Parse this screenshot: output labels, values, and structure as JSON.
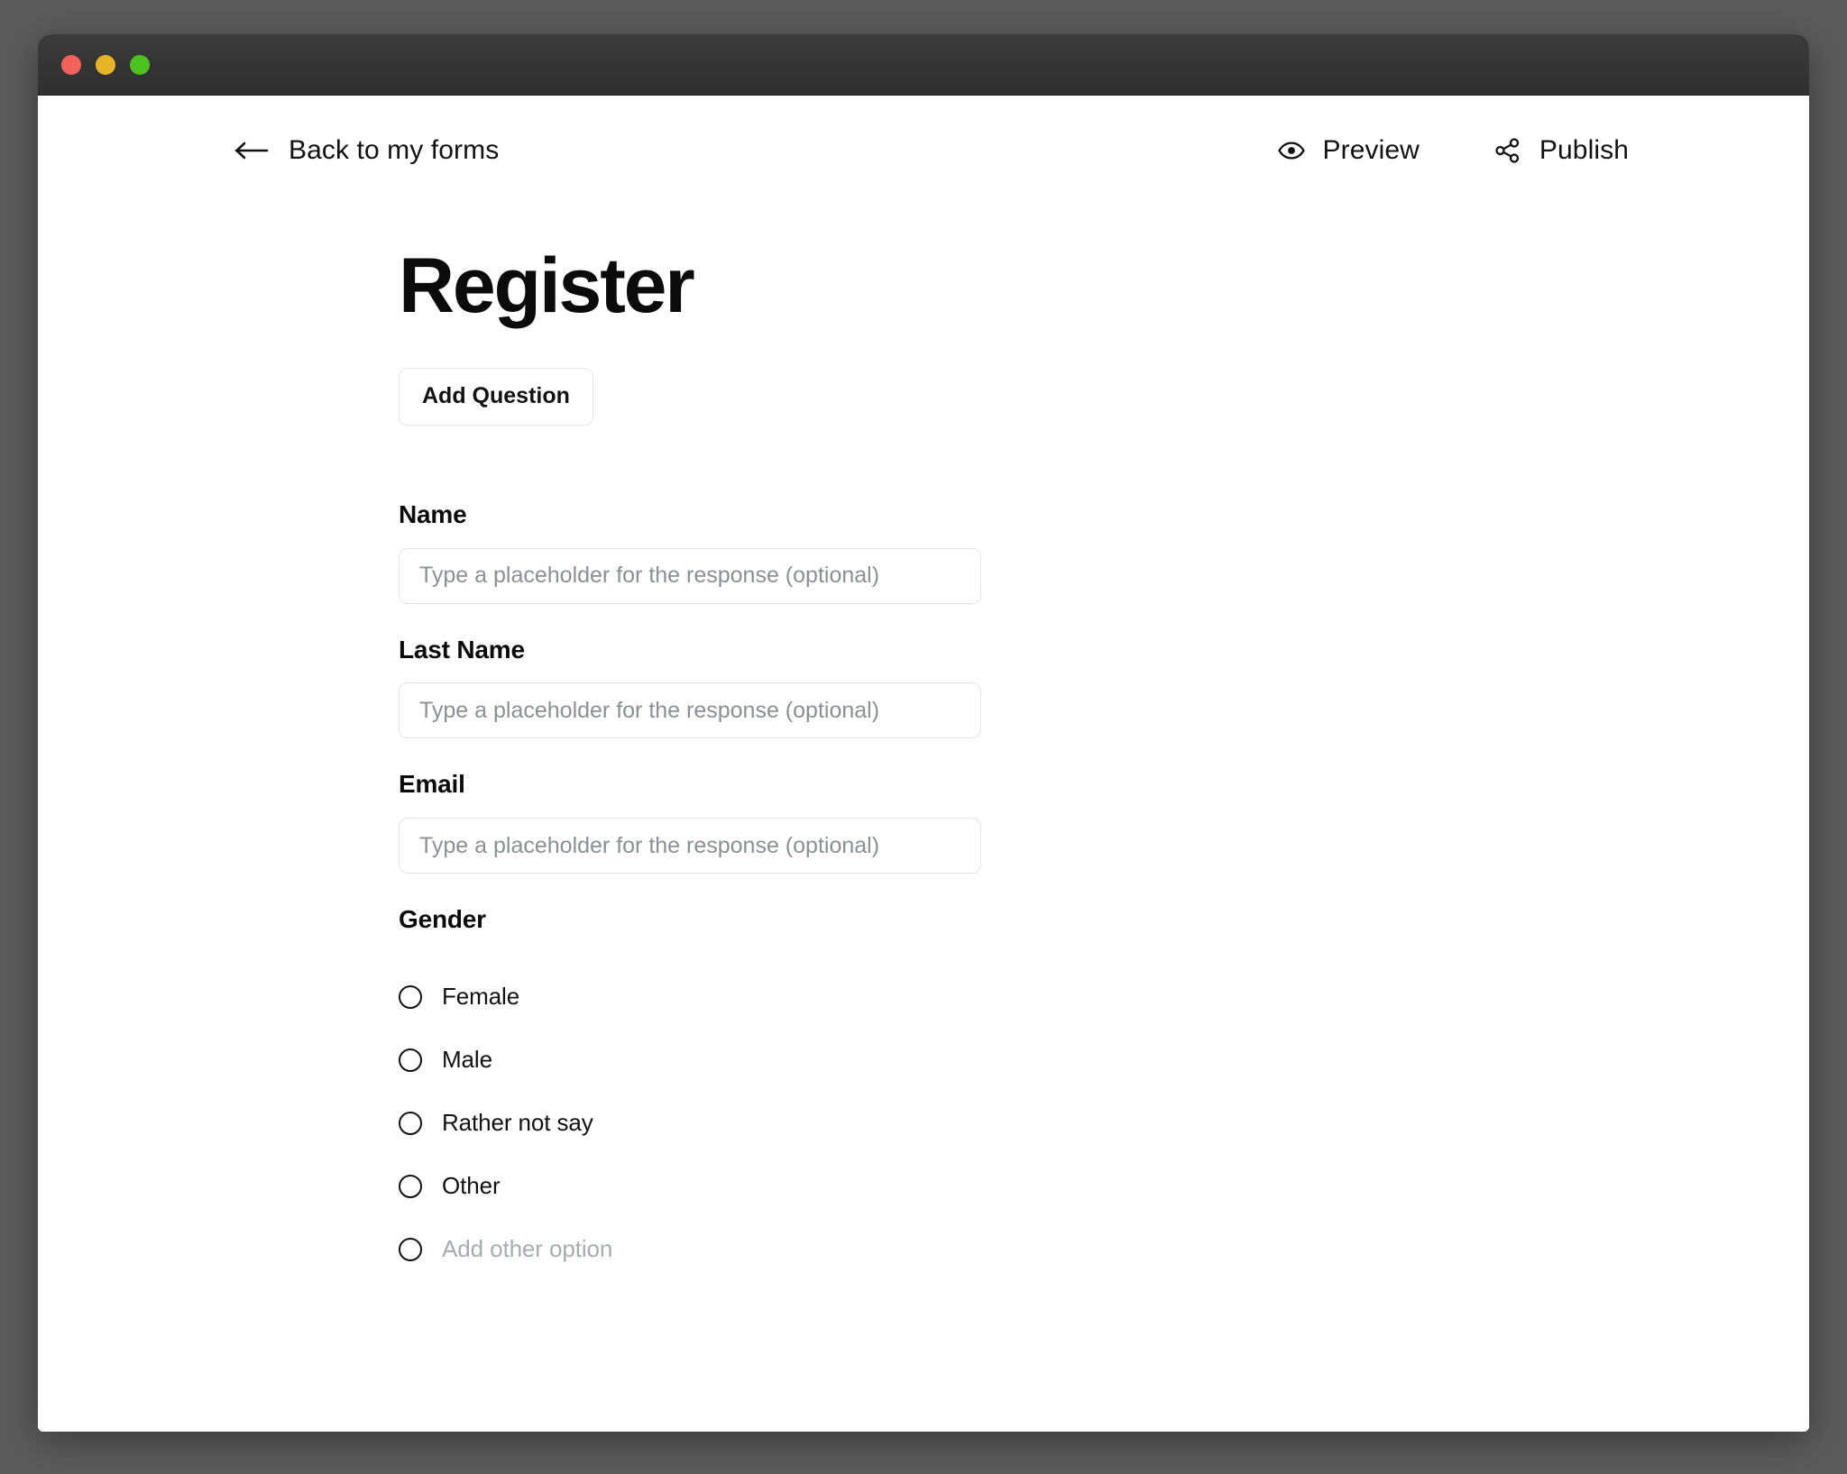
{
  "window": {
    "traffic_lights": [
      {
        "name": "close",
        "color": "#f2615a"
      },
      {
        "name": "minimize",
        "color": "#e5b527"
      },
      {
        "name": "zoom",
        "color": "#4ec222"
      }
    ]
  },
  "appbar": {
    "back_label": "Back to my forms",
    "back_icon": "arrow-left-icon",
    "actions": [
      {
        "label": "Preview",
        "icon": "eye-icon"
      },
      {
        "label": "Publish",
        "icon": "share-icon"
      }
    ]
  },
  "form": {
    "title": "Register",
    "add_question_label": "Add Question",
    "placeholder_text": "Type a placeholder for the response (optional)",
    "questions": [
      {
        "label": "Name",
        "type": "text",
        "value": "",
        "placeholder": "Type a placeholder for the response (optional)"
      },
      {
        "label": "Last Name",
        "type": "text",
        "value": "",
        "placeholder": "Type a placeholder for the response (optional)"
      },
      {
        "label": "Email",
        "type": "text",
        "value": "",
        "placeholder": "Type a placeholder for the response (optional)"
      },
      {
        "label": "Gender",
        "type": "radio",
        "options": [
          {
            "label": "Female",
            "selected": false,
            "placeholder": false
          },
          {
            "label": "Male",
            "selected": false,
            "placeholder": false
          },
          {
            "label": "Rather not say",
            "selected": false,
            "placeholder": false
          },
          {
            "label": "Other",
            "selected": false,
            "placeholder": false
          },
          {
            "label": "Add other option",
            "selected": false,
            "placeholder": true
          }
        ]
      }
    ]
  },
  "colors": {
    "page_background": "#5b5b5b",
    "titlebar": "#333333",
    "text": "#0b0b0b",
    "muted_text": "#8b8f96",
    "border": "#e4e4e7"
  }
}
